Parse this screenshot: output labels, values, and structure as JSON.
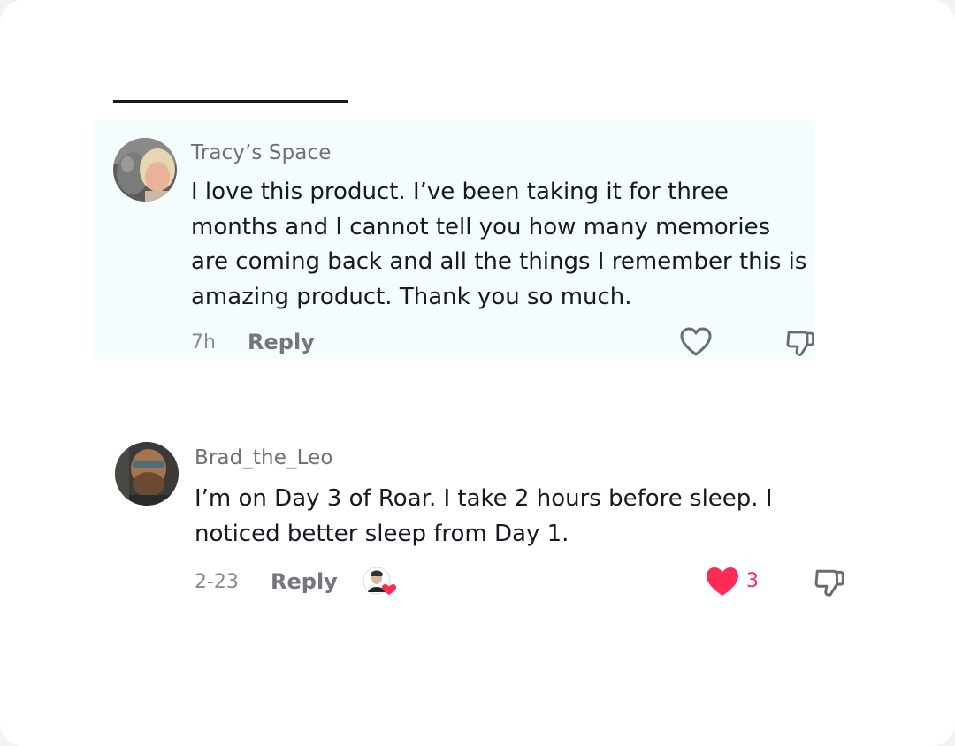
{
  "comments": [
    {
      "username": "Tracy’s Space",
      "text": "I love this product. I’ve been taking it for three months and I cannot tell you how many memories are coming back and all the things I remember this is amazing product. Thank you so much.",
      "time": "7h",
      "reply_label": "Reply",
      "like_count": "",
      "liked": false
    },
    {
      "username": "Brad_the_Leo",
      "text": "I’m on Day 3 of Roar. I take 2 hours before sleep. I noticed better sleep from Day 1.",
      "time": "2-23",
      "reply_label": "Reply",
      "like_count": "3",
      "liked": true,
      "creator_liked": true
    }
  ],
  "colors": {
    "highlight_bg": "#f5fcfd",
    "like_red": "#fe2c55",
    "text_primary": "#161823",
    "text_secondary": "#6f6f75"
  },
  "icons": {
    "like": "heart-outline-icon",
    "liked": "heart-filled-icon",
    "dislike": "thumbs-down-icon"
  }
}
